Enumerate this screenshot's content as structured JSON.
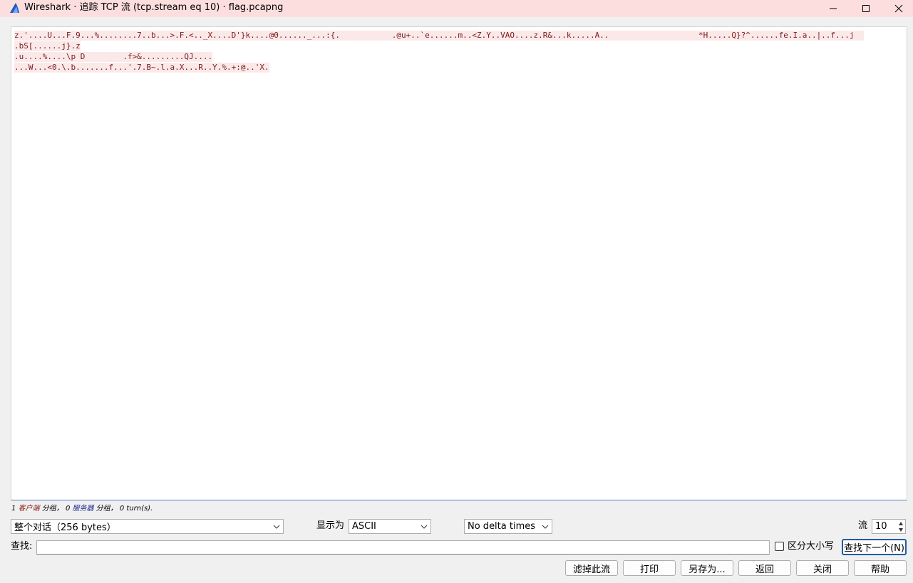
{
  "window": {
    "title": "Wireshark · 追踪 TCP 流 (tcp.stream eq 10) · flag.pcapng",
    "icon": "wireshark-fin-icon"
  },
  "stream": {
    "lines": [
      "z.'....U...F.9...%........7..b...>.F.<.._X....D'}k....@0......_...:{.           .@u+..`e......m..<Z.Y..VAO....z.R&...k.....A..",
      "*H.....Q}?^......fe.I.a..|..f...j",
      ".bS[......j}.z",
      ".u....%....\\p D        .f>&.........QJ....",
      "...W...<0.\\.b.......f...'.7.B~.l.a.X...R..Y.%.+:@..'X."
    ]
  },
  "summary": {
    "client_count": "1",
    "client_label": "客户端",
    "client_suffix": " 分组，",
    "server_count": "0",
    "server_label": "服务器",
    "server_suffix": " 分组，",
    "turns": "0 turn(s)."
  },
  "controls": {
    "conversation_select": "整个对话（256 bytes）",
    "show_as_label": "显示为",
    "show_as_value": "ASCII",
    "delta_value": "No delta times",
    "stream_label": "流",
    "stream_value": "10",
    "find_label": "查找:",
    "find_value": "",
    "case_label": "区分大小写",
    "find_next": "查找下一个(N)"
  },
  "buttons": {
    "filter_out": "滤掉此流",
    "print": "打印",
    "save_as": "另存为...",
    "back": "返回",
    "close": "关闭",
    "help": "帮助"
  },
  "colors": {
    "titlebar": "#fcdede",
    "client_text": "#7a1a1a",
    "client_bg": "#fbe9e9",
    "focus_border": "#1f5fa0"
  }
}
